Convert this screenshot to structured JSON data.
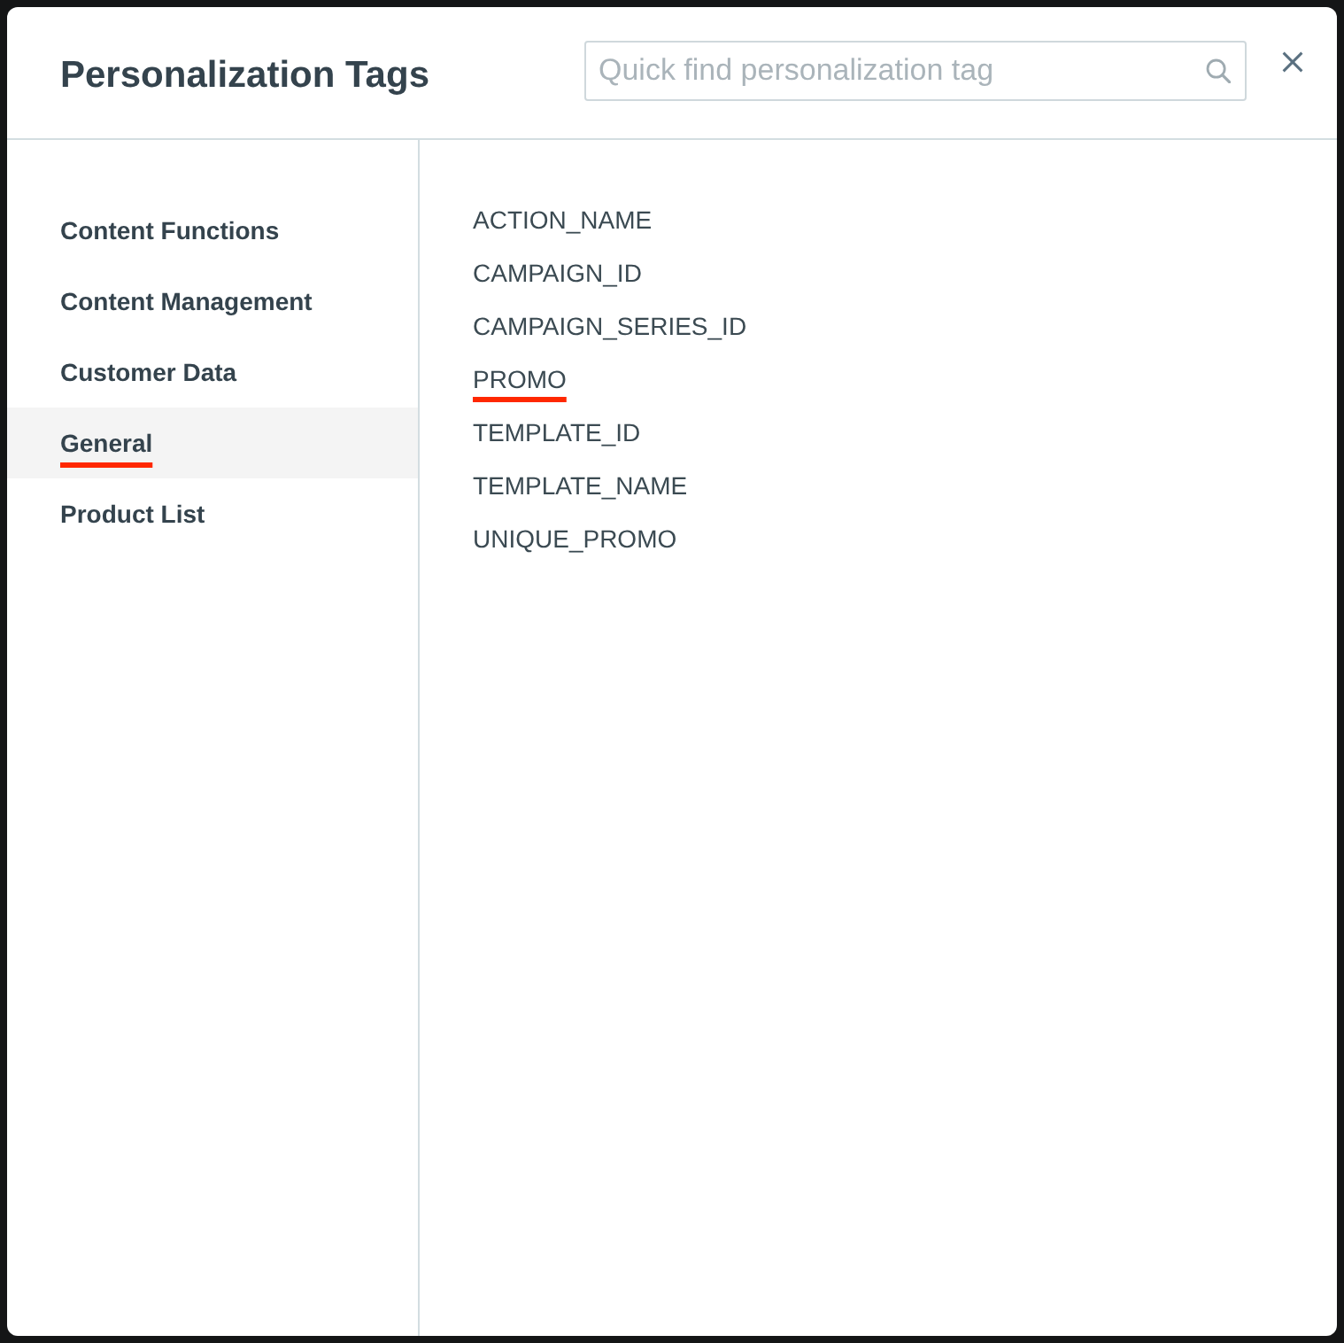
{
  "dialog": {
    "title": "Personalization Tags"
  },
  "search": {
    "placeholder": "Quick find personalization tag"
  },
  "categories": [
    {
      "label": "Content Functions",
      "selected": false
    },
    {
      "label": "Content Management",
      "selected": false
    },
    {
      "label": "Customer Data",
      "selected": false
    },
    {
      "label": "General",
      "selected": true
    },
    {
      "label": "Product List",
      "selected": false
    }
  ],
  "tags": [
    {
      "label": "ACTION_NAME",
      "selected": false
    },
    {
      "label": "CAMPAIGN_ID",
      "selected": false
    },
    {
      "label": "CAMPAIGN_SERIES_ID",
      "selected": false
    },
    {
      "label": "PROMO",
      "selected": true
    },
    {
      "label": "TEMPLATE_ID",
      "selected": false
    },
    {
      "label": "TEMPLATE_NAME",
      "selected": false
    },
    {
      "label": "UNIQUE_PROMO",
      "selected": false
    }
  ]
}
